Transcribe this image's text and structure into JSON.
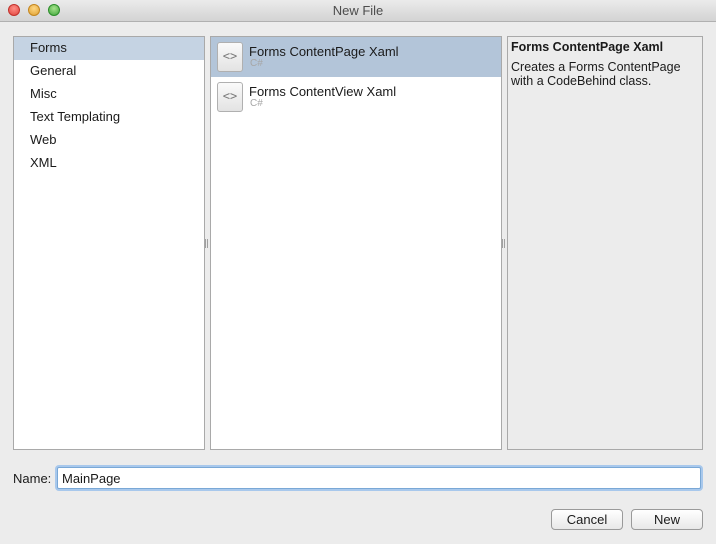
{
  "window": {
    "title": "New File"
  },
  "categories": [
    {
      "label": "Forms",
      "selected": true
    },
    {
      "label": "General",
      "selected": false
    },
    {
      "label": "Misc",
      "selected": false
    },
    {
      "label": "Text Templating",
      "selected": false
    },
    {
      "label": "Web",
      "selected": false
    },
    {
      "label": "XML",
      "selected": false
    }
  ],
  "templates": [
    {
      "name": "Forms ContentPage Xaml",
      "language": "C#",
      "icon": "code-file-icon",
      "selected": true
    },
    {
      "name": "Forms ContentView Xaml",
      "language": "C#",
      "icon": "code-file-icon",
      "selected": false
    }
  ],
  "icon_glyph": "<>",
  "description": {
    "title": "Forms ContentPage Xaml",
    "text": "Creates a Forms ContentPage with a CodeBehind class."
  },
  "name_field": {
    "label": "Name:",
    "value": "MainPage"
  },
  "buttons": {
    "cancel": "Cancel",
    "new": "New"
  },
  "colors": {
    "category_selected": "#c5d3e3",
    "template_selected": "#b3c5d9",
    "focus_ring": "#a8c8ec"
  }
}
